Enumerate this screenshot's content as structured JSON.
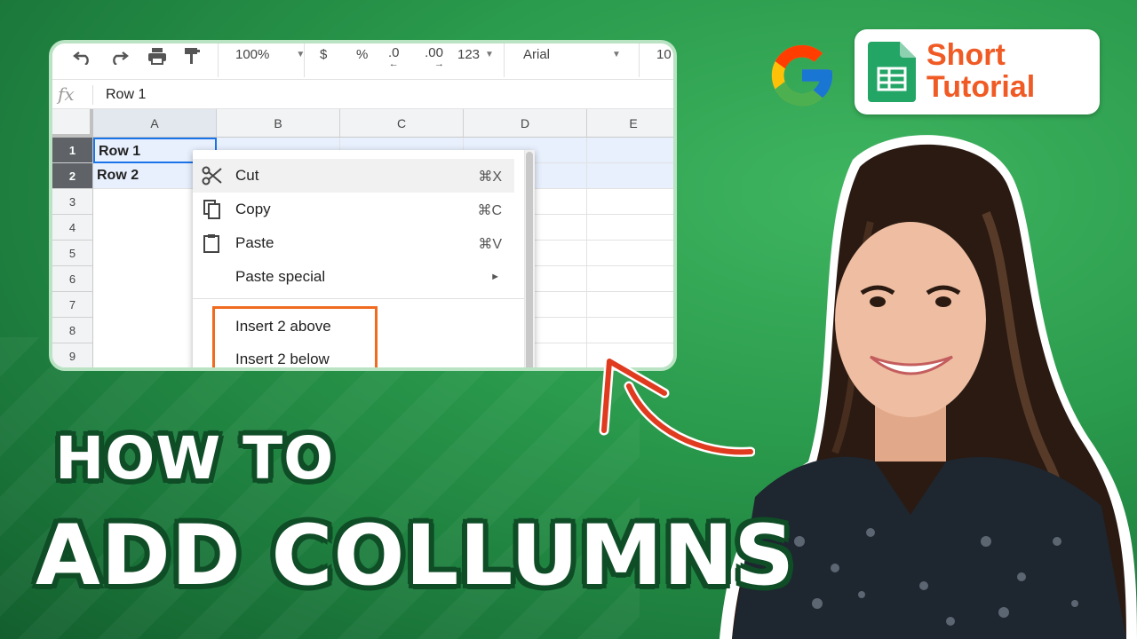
{
  "toolbar": {
    "zoom": "100%",
    "currency": "$",
    "percent": "%",
    "dec_less": ".0",
    "dec_more": ".00",
    "format": "123",
    "font": "Arial",
    "font_size": "10"
  },
  "formula_bar": {
    "fx_label": "fx",
    "value": "Row 1"
  },
  "grid": {
    "columns": [
      "A",
      "B",
      "C",
      "D",
      "E"
    ],
    "rows": [
      "1",
      "2",
      "3",
      "4",
      "5",
      "6",
      "7",
      "8",
      "9"
    ],
    "cells": {
      "a1": "Row 1",
      "a2": "Row 2"
    }
  },
  "context_menu": {
    "items": [
      {
        "label": "Cut",
        "shortcut": "⌘X",
        "icon": "scissors-icon"
      },
      {
        "label": "Copy",
        "shortcut": "⌘C",
        "icon": "copy-icon"
      },
      {
        "label": "Paste",
        "shortcut": "⌘V",
        "icon": "clipboard-icon"
      },
      {
        "label": "Paste special",
        "submenu_arrow": "►"
      },
      {
        "label": "Insert 2 above"
      },
      {
        "label": "Insert 2 below"
      }
    ]
  },
  "badge": {
    "line1": "Short",
    "line2": "Tutorial",
    "accent_color": "#f05a24"
  },
  "headline": {
    "line1": "HOW TO",
    "line2": "ADD COLLUMNS"
  },
  "colors": {
    "background": "#2a9a4c",
    "highlight": "#f06a1f",
    "arrow": "#e03a1f",
    "selection": "#e8f0fe"
  }
}
